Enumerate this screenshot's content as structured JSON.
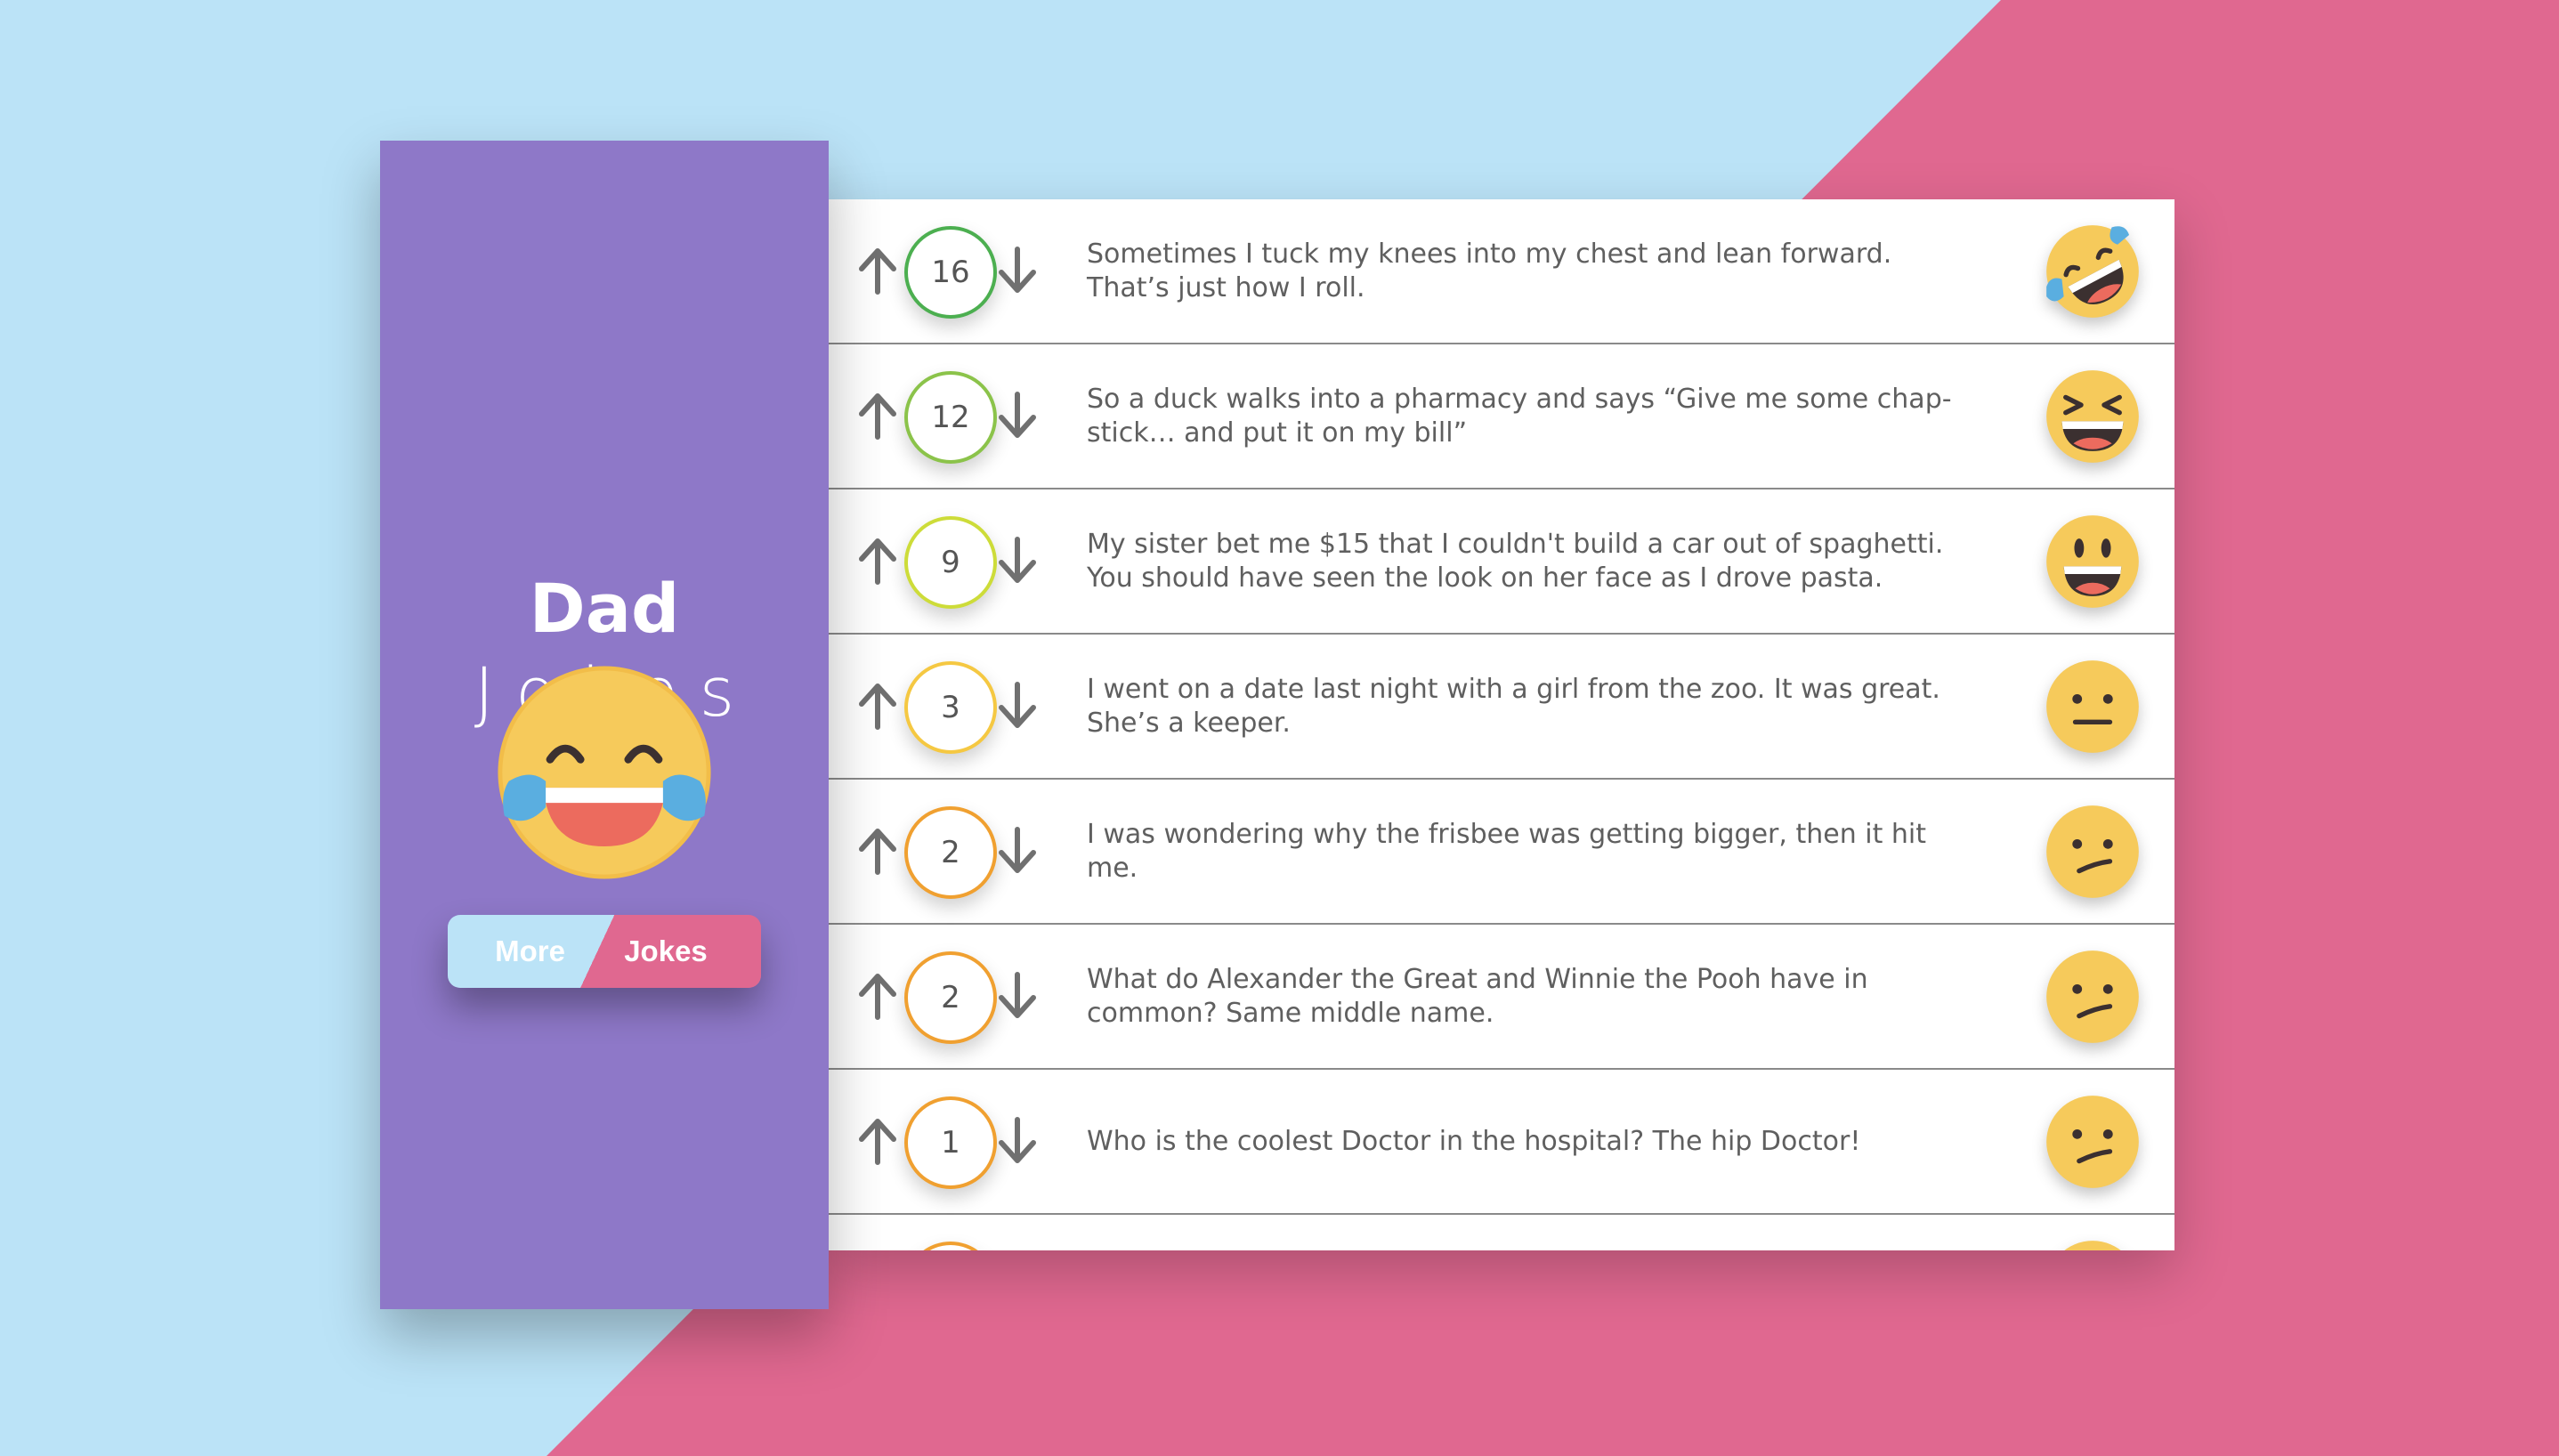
{
  "app": {
    "title": "Dad",
    "subtitle": "Jokes"
  },
  "colors": {
    "background_left": "#bbe3f7",
    "background_right": "#e06890",
    "sidebar": "#8e78c8",
    "text": "#5f5f5f",
    "arrow": "#707070",
    "emoji_face": "#f6ca5b"
  },
  "more_jokes_button": {
    "label_more": "More",
    "label_jokes": "Jokes"
  },
  "sidebar_emoji_icon": "face-with-tears-of-joy-icon",
  "jokes": [
    {
      "score": "16",
      "text": "Sometimes I tuck my knees into my chest and lean forward. That’s just how I roll.",
      "emoji": "rolling-on-floor-laughing-icon",
      "color": "#4caf50"
    },
    {
      "score": "12",
      "text": "So a duck walks into a pharmacy and says “Give me some chap-stick… and put it on my bill”",
      "emoji": "grinning-squinting-face-icon",
      "color": "#8bc34a"
    },
    {
      "score": "9",
      "text": "My sister bet me $15 that I couldn't build a car out of spaghetti. You should have seen the look on her face as I drove pasta.",
      "emoji": "grinning-face-icon",
      "color": "#cddc39"
    },
    {
      "score": "3",
      "text": "I went on a date last night with a girl from the zoo. It was great. She’s a keeper.",
      "emoji": "neutral-face-icon",
      "color": "#f5c842"
    },
    {
      "score": "2",
      "text": "I was wondering why the frisbee was getting bigger, then it hit me.",
      "emoji": "confused-face-icon",
      "color": "#f0a030"
    },
    {
      "score": "2",
      "text": "What do Alexander the Great and Winnie the Pooh have in common? Same middle name.",
      "emoji": "confused-face-icon",
      "color": "#f0a030"
    },
    {
      "score": "1",
      "text": "Who is the coolest Doctor in the hospital? The hip Doctor!",
      "emoji": "confused-face-icon",
      "color": "#f0a030"
    },
    {
      "score": "",
      "text": "",
      "emoji": "confused-face-icon",
      "color": "#f0a030"
    }
  ]
}
